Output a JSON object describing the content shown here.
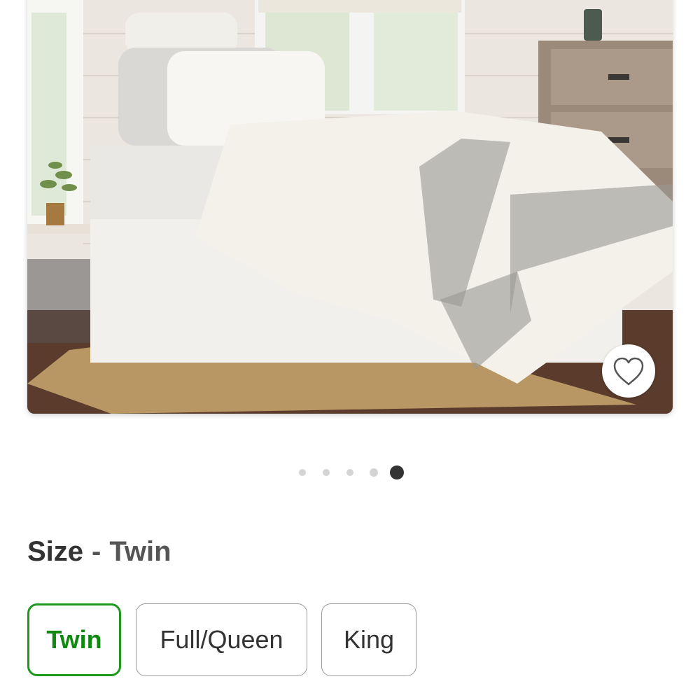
{
  "product_image": {
    "alt": "Twin bed with white embroidered duvet, striped sheets, bed skirt and jute rug"
  },
  "favorite": {
    "icon": "heart-outline-icon"
  },
  "carousel": {
    "total": 5,
    "active_index": 4
  },
  "size_selector": {
    "label": "Size",
    "separator": "-",
    "selected_value": "Twin",
    "options": [
      {
        "label": "Twin",
        "selected": true
      },
      {
        "label": "Full/Queen",
        "selected": false
      },
      {
        "label": "King",
        "selected": false
      }
    ]
  },
  "colors": {
    "selected_border": "#1d9a1d",
    "selected_text": "#118811",
    "active_dot": "#333333",
    "inactive_dot": "#d4d4d4"
  }
}
